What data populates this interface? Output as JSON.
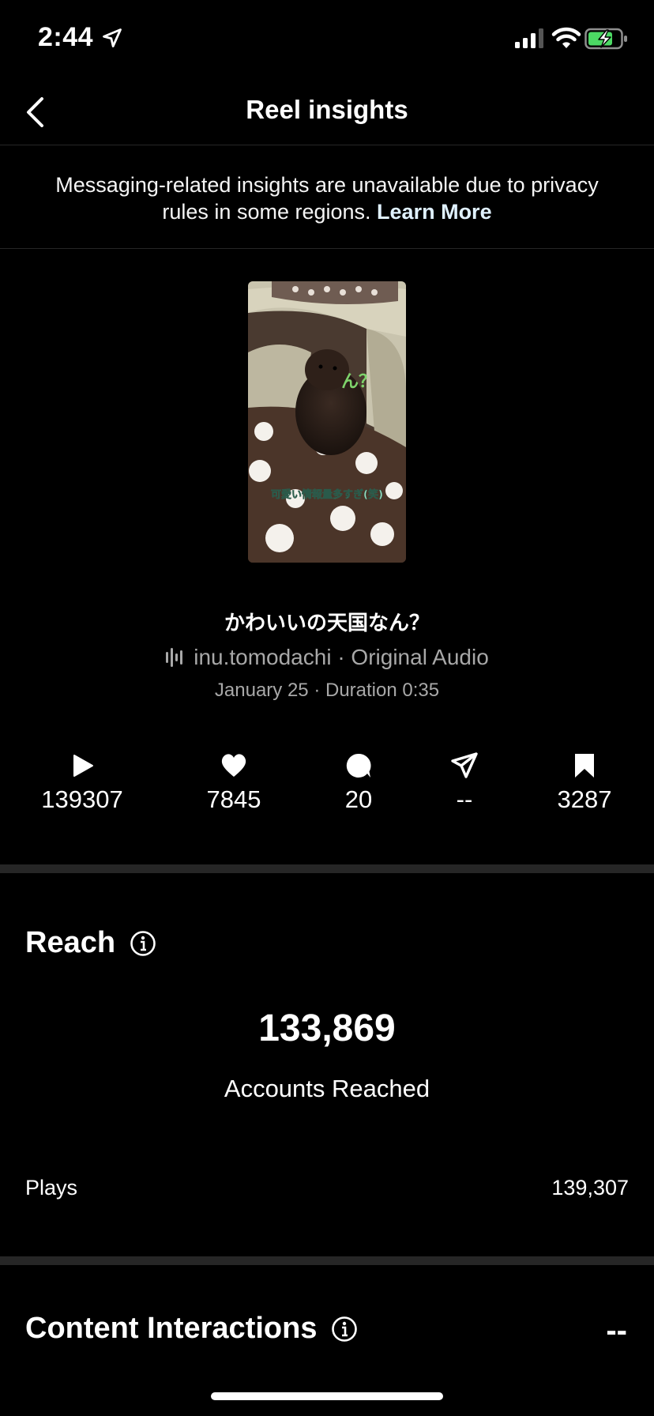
{
  "status_bar": {
    "time": "2:44"
  },
  "nav": {
    "title": "Reel insights"
  },
  "notice": {
    "text": "Messaging-related insights are unavailable due to privacy rules in some regions.",
    "link": "Learn More"
  },
  "thumbnail": {
    "caption_top": "ん？",
    "caption_bottom": "可愛い情報量多すぎ(笑)"
  },
  "reel": {
    "title": "かわいいの天国なん？",
    "audio": "inu.tomodachi · Original Audio",
    "meta": "January 25 · Duration 0:35"
  },
  "stats": {
    "plays": "139307",
    "likes": "7845",
    "comments": "20",
    "shares": "--",
    "saves": "3287"
  },
  "reach": {
    "title": "Reach",
    "value": "133,869",
    "label": "Accounts Reached",
    "plays_label": "Plays",
    "plays_value": "139,307"
  },
  "content_interactions": {
    "title": "Content Interactions",
    "value": "--"
  }
}
